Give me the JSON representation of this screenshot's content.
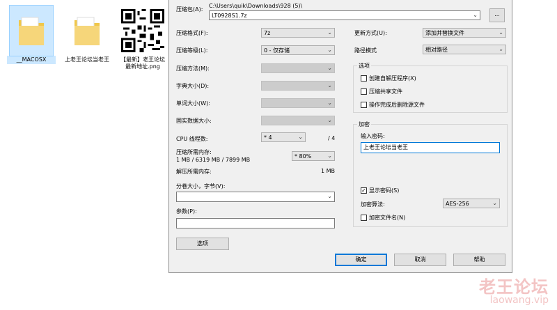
{
  "desktop": {
    "icons": [
      {
        "label": "__MACOSX"
      },
      {
        "label": "上老王论坛当老王"
      },
      {
        "label": "【最新】老王论坛最新地址.png"
      }
    ]
  },
  "dialog": {
    "archive_label": "压缩包(A):",
    "archive_path": "C:\\Users\\quik\\Downloads\\928 (5)\\",
    "archive_name": "LT0928S1.7z",
    "browse_label": "...",
    "format_label": "压缩格式(F):",
    "format_value": "7z",
    "level_label": "压缩等级(L):",
    "level_value": "0 - 仅存储",
    "method_label": "压缩方法(M):",
    "dict_label": "字典大小(D):",
    "word_label": "单词大小(W):",
    "solid_label": "固实数据大小:",
    "cpu_label": "CPU 线程数:",
    "cpu_value": "* 4",
    "cpu_total": "/ 4",
    "mem_comp_label": "压缩所需内存:",
    "mem_comp_value": "1 MB / 6319 MB / 7899 MB",
    "mem_pct_value": "* 80%",
    "mem_decomp_label": "解压所需内存:",
    "mem_decomp_value": "1 MB",
    "volume_label": "分卷大小，字节(V):",
    "params_label": "参数(P):",
    "options_button": "选项",
    "update_label": "更新方式(U):",
    "update_value": "添加并替换文件",
    "path_label": "路径模式",
    "path_value": "相对路径",
    "options_group": "选项",
    "opt_sfx": "创建自解压程序(X)",
    "opt_shared": "压缩共享文件",
    "opt_delete": "操作完成后删除源文件",
    "enc_group": "加密",
    "enc_pw_label": "输入密码:",
    "enc_pw_value": "上老王论坛当老王",
    "enc_show": "显示密码(S)",
    "enc_method_label": "加密算法:",
    "enc_method_value": "AES-256",
    "enc_names": "加密文件名(N)",
    "ok_button": "确定",
    "cancel_button": "取消",
    "help_button": "帮助"
  },
  "watermark": {
    "title": "老王论坛",
    "url": "laowang.vip"
  }
}
